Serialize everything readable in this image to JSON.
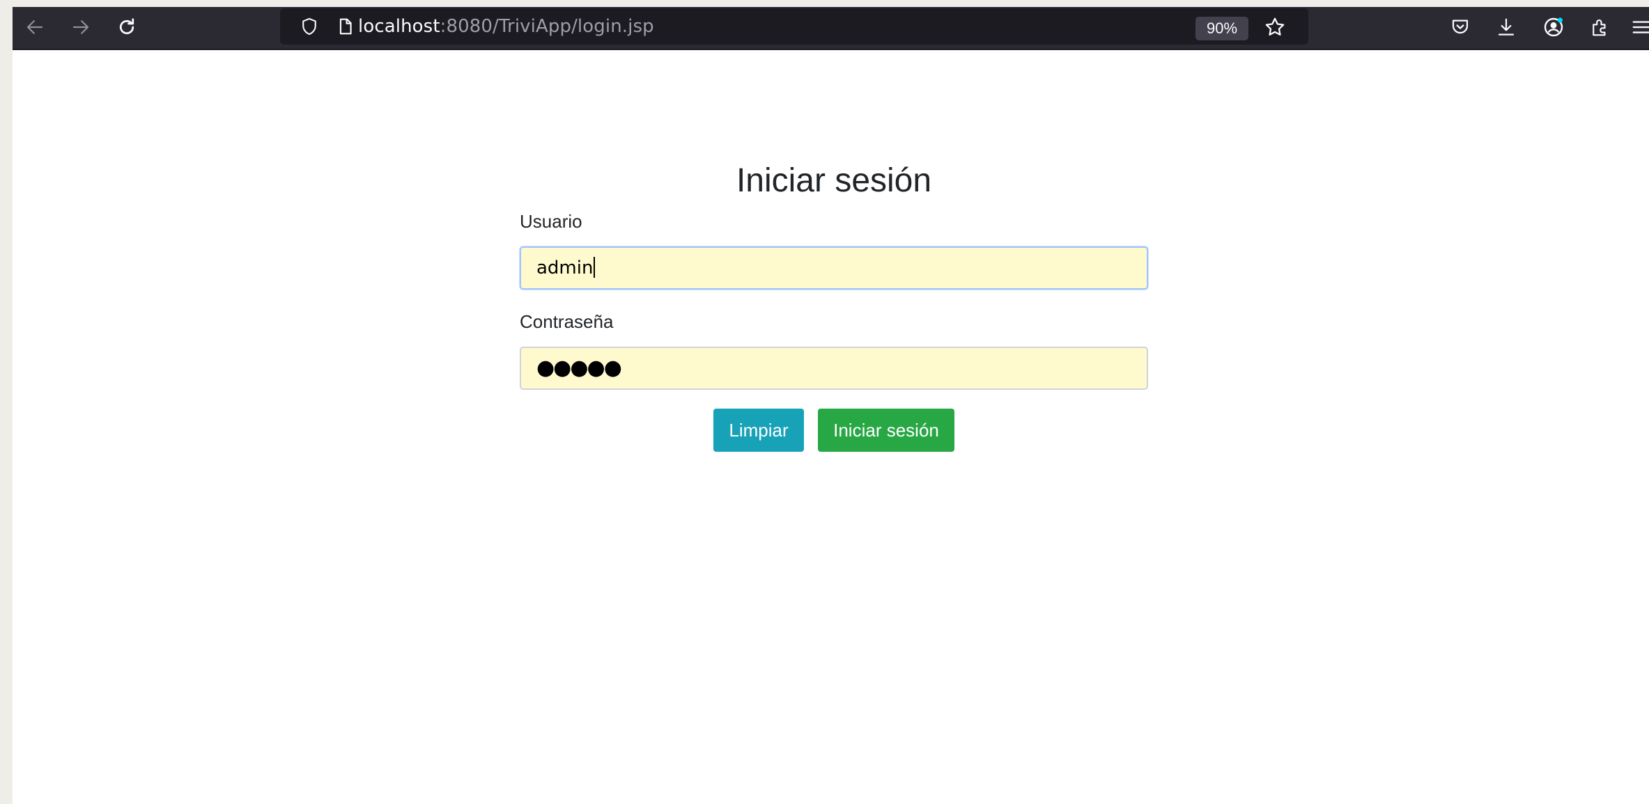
{
  "browser": {
    "url_host": "localhost",
    "url_rest": ":8080/TriviApp/login.jsp",
    "zoom": "90%"
  },
  "login": {
    "title": "Iniciar sesión",
    "username_label": "Usuario",
    "username_value": "admin",
    "password_label": "Contraseña",
    "password_mask": "●●●●●",
    "clear_button": "Limpiar",
    "submit_button": "Iniciar sesión"
  }
}
